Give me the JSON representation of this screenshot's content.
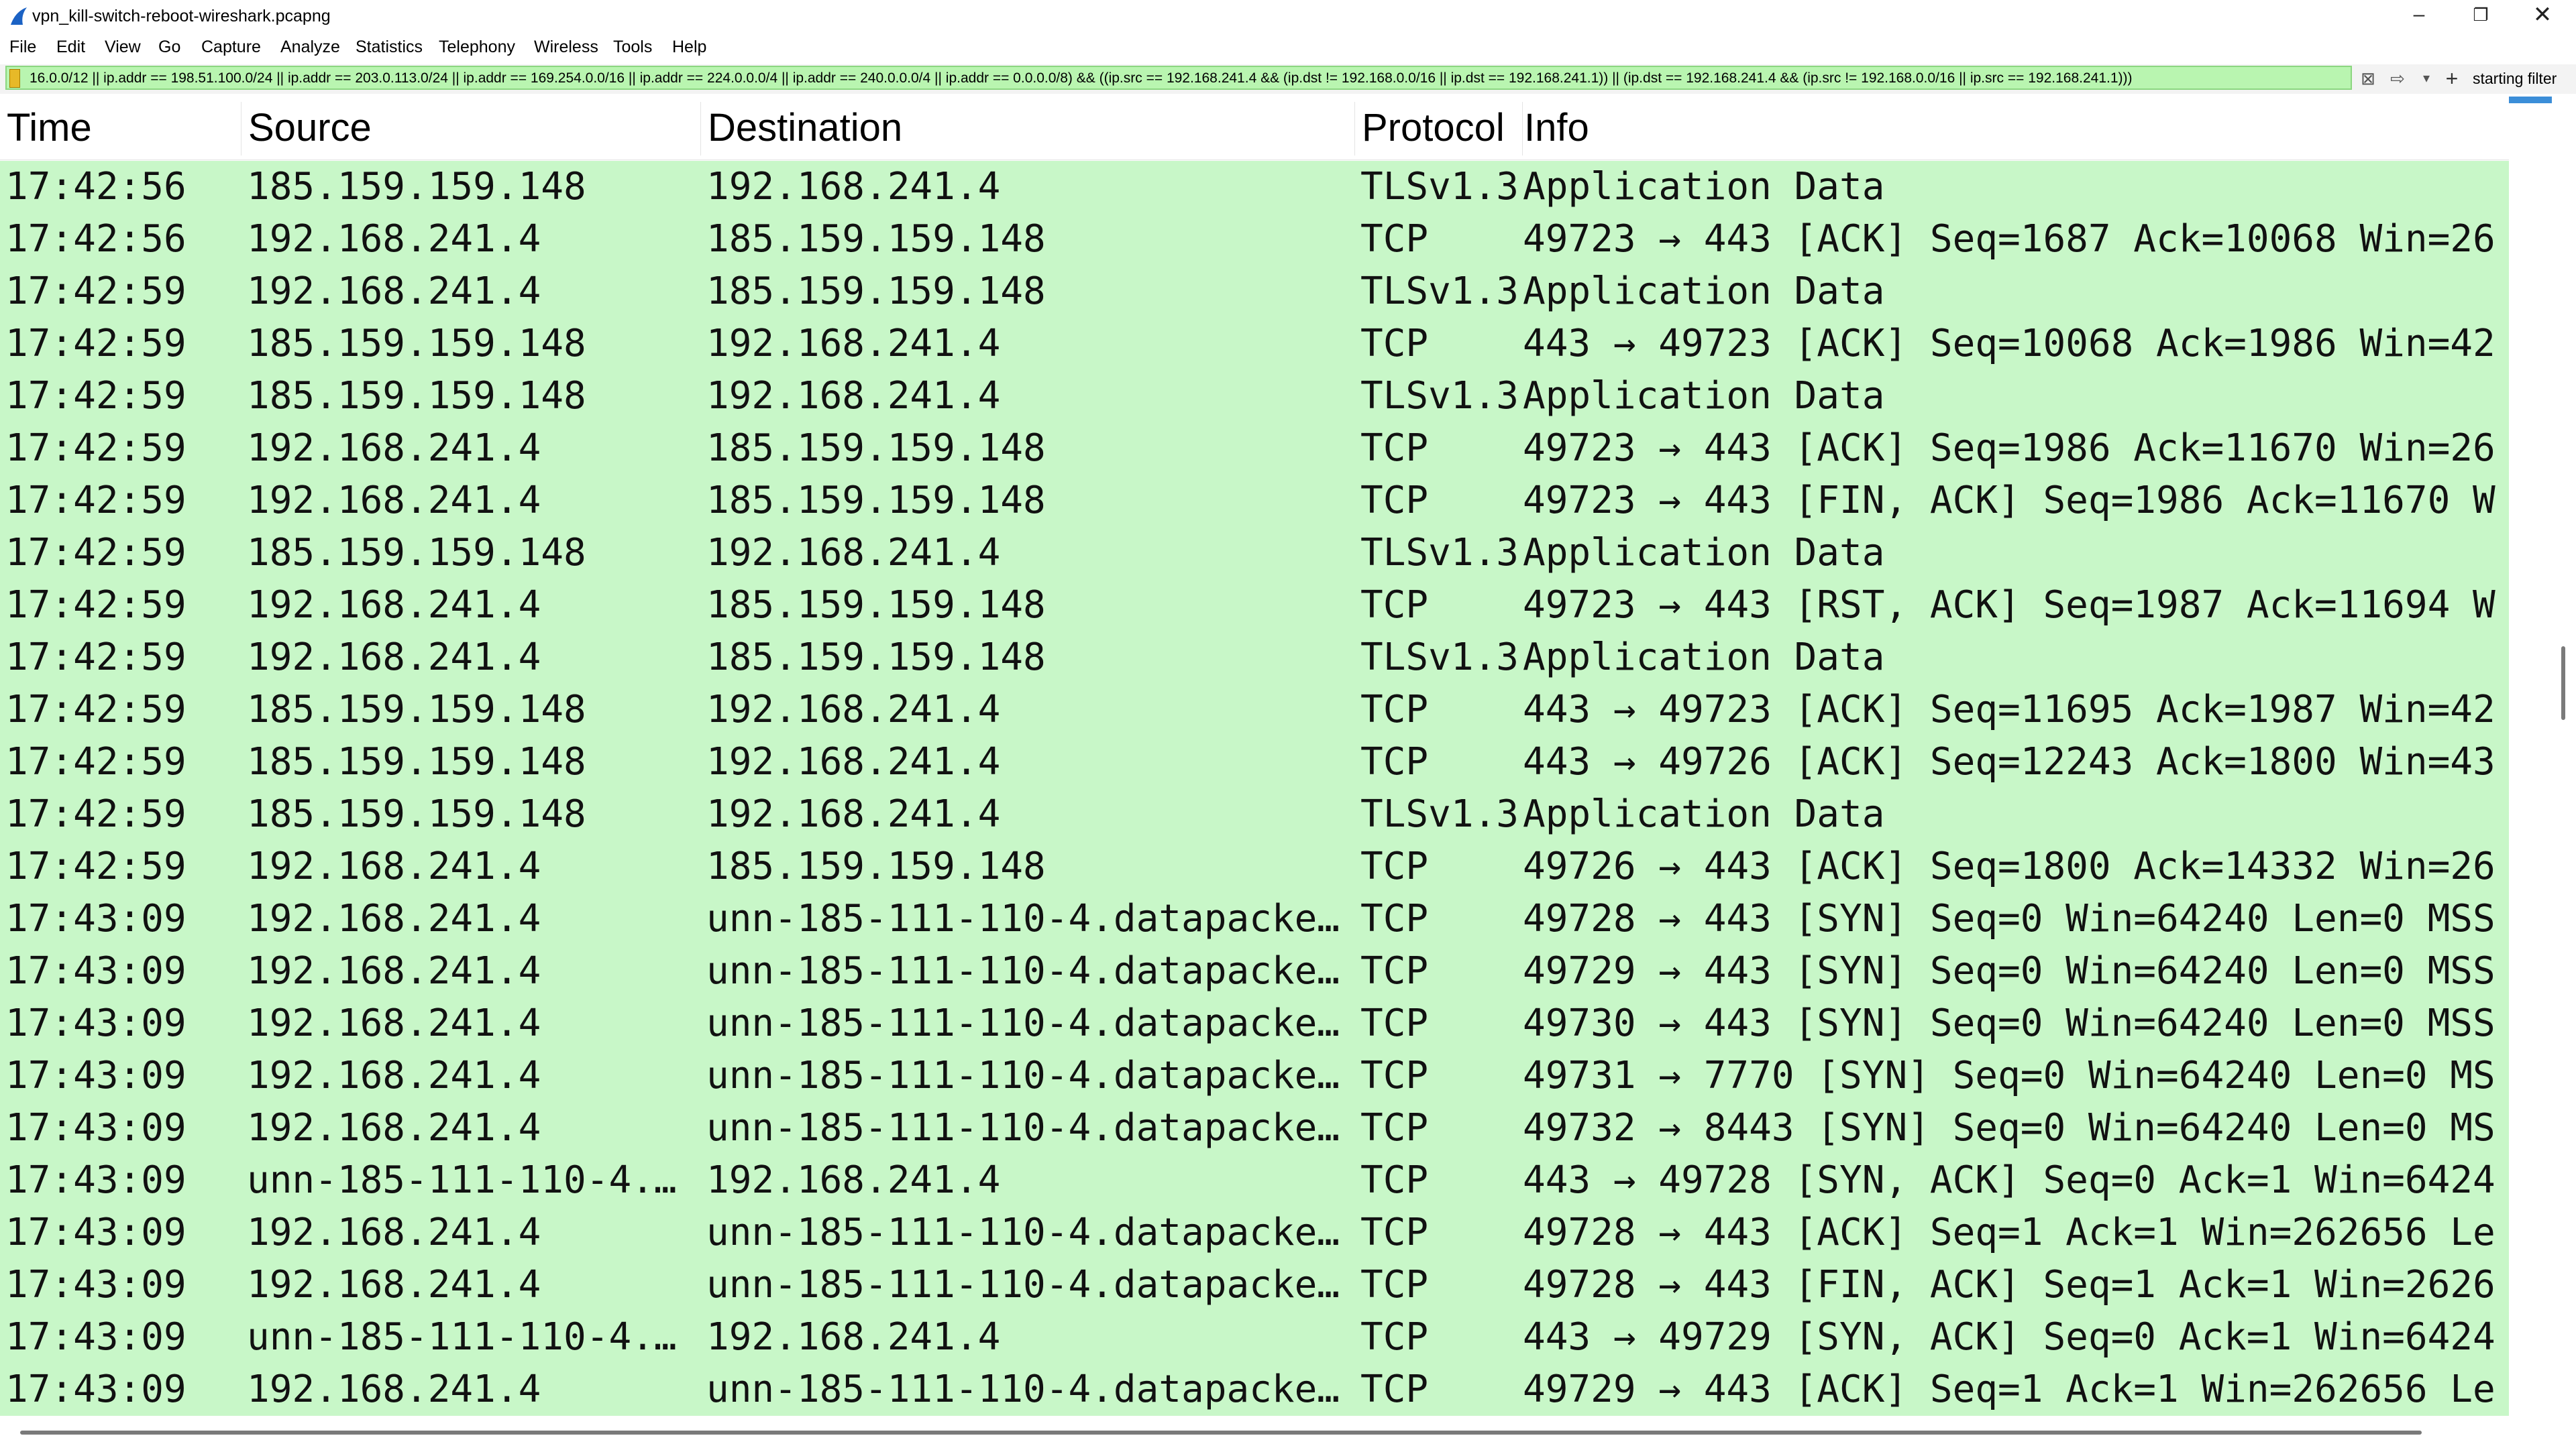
{
  "window": {
    "title": "vpn_kill-switch-reboot-wireshark.pcapng",
    "minimize_glyph": "–",
    "maximize_glyph": "❐",
    "close_glyph": "✕"
  },
  "menu": [
    "File",
    "Edit",
    "View",
    "Go",
    "Capture",
    "Analyze",
    "Statistics",
    "Telephony",
    "Wireless",
    "Tools",
    "Help"
  ],
  "filter": {
    "text": "16.0.0/12 || ip.addr == 198.51.100.0/24 || ip.addr == 203.0.113.0/24 || ip.addr == 169.254.0.0/16 || ip.addr == 224.0.0.0/4 || ip.addr == 240.0.0.0/4 || ip.addr == 0.0.0.0/8) && ((ip.src == 192.168.241.4 && (ip.dst != 192.168.0.0/16 || ip.dst == 192.168.241.1)) || (ip.dst == 192.168.241.4 && (ip.src != 192.168.0.0/16 || ip.src == 192.168.241.1)))",
    "label": "starting filter",
    "clear_glyph": "⊠",
    "apply_glyph": "⇨",
    "dropdown_glyph": "▾",
    "add_glyph": "+",
    "color": "#b9f5b0"
  },
  "columns": [
    "Time",
    "Source",
    "Destination",
    "Protocol",
    "Info"
  ],
  "row_color": "#c8f7c8",
  "packets": [
    {
      "time": "17:42:56",
      "source": "185.159.159.148",
      "destination": "192.168.241.4",
      "protocol": "TLSv1.3",
      "info": "Application Data"
    },
    {
      "time": "17:42:56",
      "source": "192.168.241.4",
      "destination": "185.159.159.148",
      "protocol": "TCP",
      "info": "49723 → 443 [ACK] Seq=1687 Ack=10068 Win=26"
    },
    {
      "time": "17:42:59",
      "source": "192.168.241.4",
      "destination": "185.159.159.148",
      "protocol": "TLSv1.3",
      "info": "Application Data"
    },
    {
      "time": "17:42:59",
      "source": "185.159.159.148",
      "destination": "192.168.241.4",
      "protocol": "TCP",
      "info": "443 → 49723 [ACK] Seq=10068 Ack=1986 Win=42"
    },
    {
      "time": "17:42:59",
      "source": "185.159.159.148",
      "destination": "192.168.241.4",
      "protocol": "TLSv1.3",
      "info": "Application Data"
    },
    {
      "time": "17:42:59",
      "source": "192.168.241.4",
      "destination": "185.159.159.148",
      "protocol": "TCP",
      "info": "49723 → 443 [ACK] Seq=1986 Ack=11670 Win=26"
    },
    {
      "time": "17:42:59",
      "source": "192.168.241.4",
      "destination": "185.159.159.148",
      "protocol": "TCP",
      "info": "49723 → 443 [FIN, ACK] Seq=1986 Ack=11670 W"
    },
    {
      "time": "17:42:59",
      "source": "185.159.159.148",
      "destination": "192.168.241.4",
      "protocol": "TLSv1.3",
      "info": "Application Data"
    },
    {
      "time": "17:42:59",
      "source": "192.168.241.4",
      "destination": "185.159.159.148",
      "protocol": "TCP",
      "info": "49723 → 443 [RST, ACK] Seq=1987 Ack=11694 W"
    },
    {
      "time": "17:42:59",
      "source": "192.168.241.4",
      "destination": "185.159.159.148",
      "protocol": "TLSv1.3",
      "info": "Application Data"
    },
    {
      "time": "17:42:59",
      "source": "185.159.159.148",
      "destination": "192.168.241.4",
      "protocol": "TCP",
      "info": "443 → 49723 [ACK] Seq=11695 Ack=1987 Win=42"
    },
    {
      "time": "17:42:59",
      "source": "185.159.159.148",
      "destination": "192.168.241.4",
      "protocol": "TCP",
      "info": "443 → 49726 [ACK] Seq=12243 Ack=1800 Win=43"
    },
    {
      "time": "17:42:59",
      "source": "185.159.159.148",
      "destination": "192.168.241.4",
      "protocol": "TLSv1.3",
      "info": "Application Data"
    },
    {
      "time": "17:42:59",
      "source": "192.168.241.4",
      "destination": "185.159.159.148",
      "protocol": "TCP",
      "info": "49726 → 443 [ACK] Seq=1800 Ack=14332 Win=26"
    },
    {
      "time": "17:43:09",
      "source": "192.168.241.4",
      "destination": "unn-185-111-110-4.datapacke…",
      "protocol": "TCP",
      "info": "49728 → 443 [SYN] Seq=0 Win=64240 Len=0 MSS"
    },
    {
      "time": "17:43:09",
      "source": "192.168.241.4",
      "destination": "unn-185-111-110-4.datapacke…",
      "protocol": "TCP",
      "info": "49729 → 443 [SYN] Seq=0 Win=64240 Len=0 MSS"
    },
    {
      "time": "17:43:09",
      "source": "192.168.241.4",
      "destination": "unn-185-111-110-4.datapacke…",
      "protocol": "TCP",
      "info": "49730 → 443 [SYN] Seq=0 Win=64240 Len=0 MSS"
    },
    {
      "time": "17:43:09",
      "source": "192.168.241.4",
      "destination": "unn-185-111-110-4.datapacke…",
      "protocol": "TCP",
      "info": "49731 → 7770 [SYN] Seq=0 Win=64240 Len=0 MS"
    },
    {
      "time": "17:43:09",
      "source": "192.168.241.4",
      "destination": "unn-185-111-110-4.datapacke…",
      "protocol": "TCP",
      "info": "49732 → 8443 [SYN] Seq=0 Win=64240 Len=0 MS"
    },
    {
      "time": "17:43:09",
      "source": "unn-185-111-110-4.…",
      "destination": "192.168.241.4",
      "protocol": "TCP",
      "info": "443 → 49728 [SYN, ACK] Seq=0 Ack=1 Win=6424"
    },
    {
      "time": "17:43:09",
      "source": "192.168.241.4",
      "destination": "unn-185-111-110-4.datapacke…",
      "protocol": "TCP",
      "info": "49728 → 443 [ACK] Seq=1 Ack=1 Win=262656 Le"
    },
    {
      "time": "17:43:09",
      "source": "192.168.241.4",
      "destination": "unn-185-111-110-4.datapacke…",
      "protocol": "TCP",
      "info": "49728 → 443 [FIN, ACK] Seq=1 Ack=1 Win=2626"
    },
    {
      "time": "17:43:09",
      "source": "unn-185-111-110-4.…",
      "destination": "192.168.241.4",
      "protocol": "TCP",
      "info": "443 → 49729 [SYN, ACK] Seq=0 Ack=1 Win=6424"
    },
    {
      "time": "17:43:09",
      "source": "192.168.241.4",
      "destination": "unn-185-111-110-4.datapacke…",
      "protocol": "TCP",
      "info": "49729 → 443 [ACK] Seq=1 Ack=1 Win=262656 Le"
    }
  ]
}
